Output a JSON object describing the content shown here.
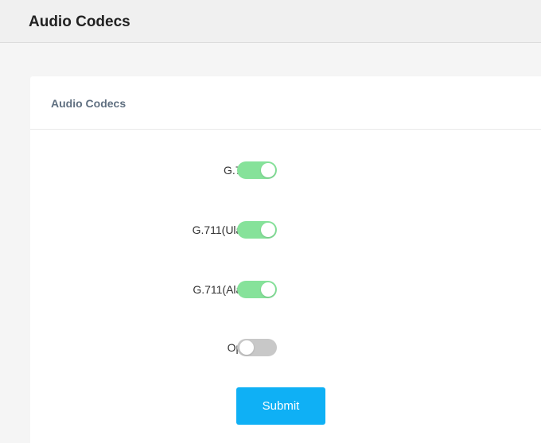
{
  "page": {
    "title": "Audio Codecs"
  },
  "panel": {
    "title": "Audio Codecs"
  },
  "codecs": [
    {
      "label": "G.722:",
      "enabled": true
    },
    {
      "label": "G.711(Ulaw):",
      "enabled": true
    },
    {
      "label": "G.711(Alaw):",
      "enabled": true
    },
    {
      "label": "Opus:",
      "enabled": false
    }
  ],
  "actions": {
    "submit_label": "Submit"
  },
  "colors": {
    "toggle_on": "#86e29a",
    "toggle_off": "#c8c8c8",
    "submit_button": "#0fb0f5"
  }
}
